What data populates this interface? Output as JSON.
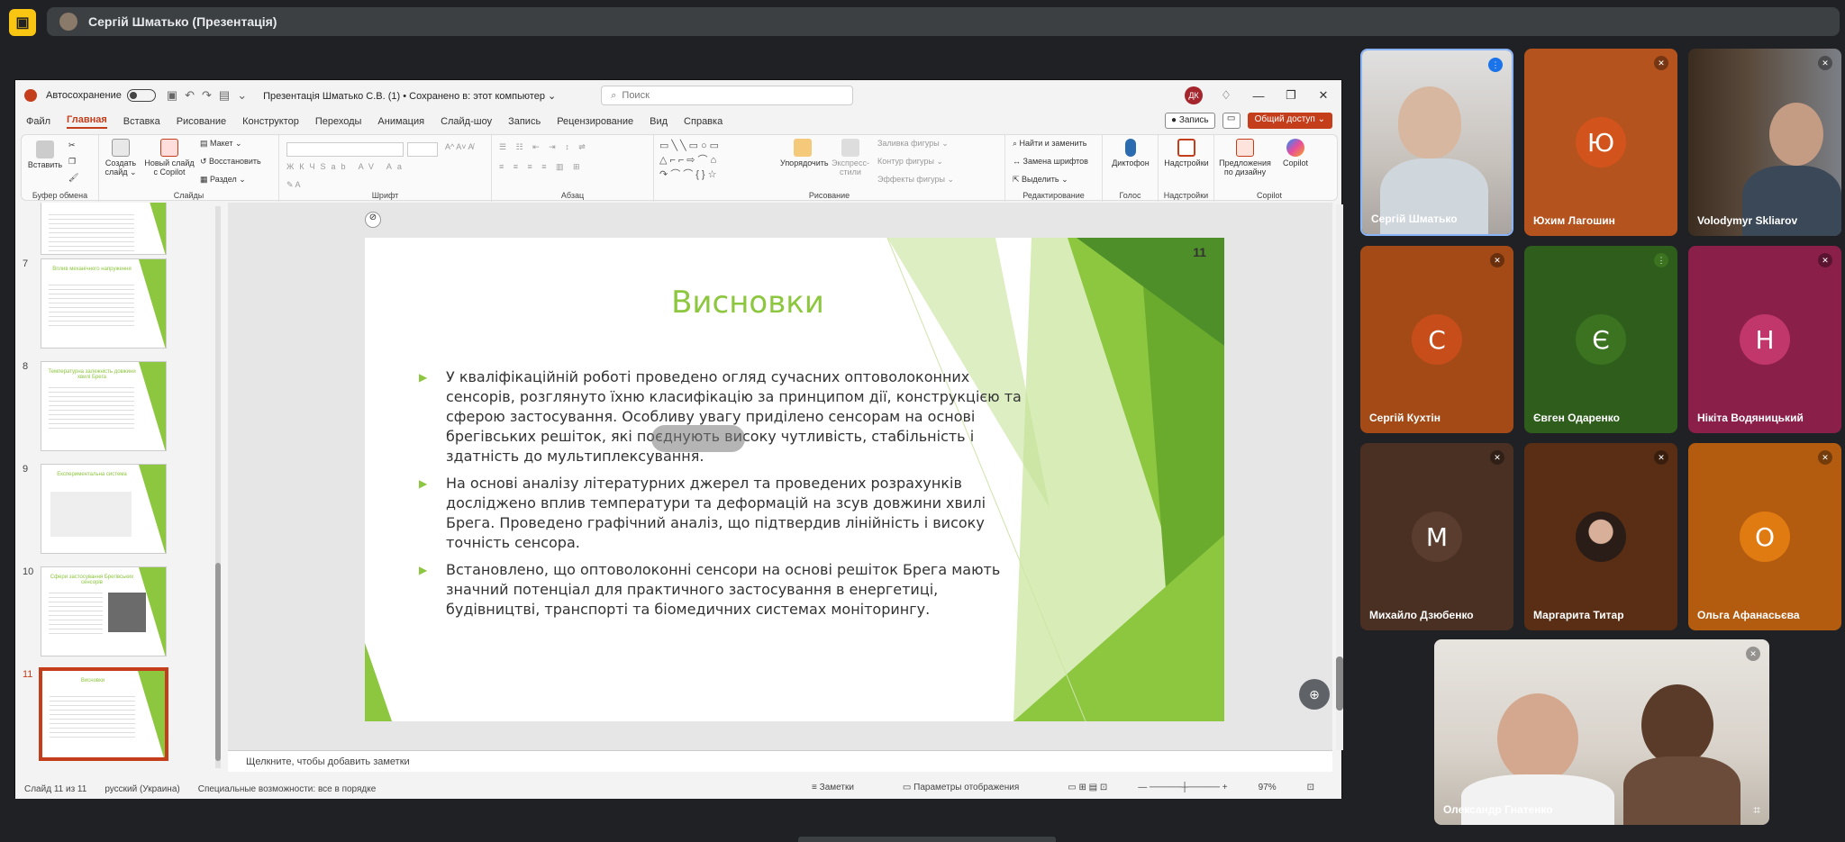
{
  "meet": {
    "presenter_label": "Сергій Шматько (Презентація)",
    "participants": [
      {
        "name": "Сергій Шматько",
        "initial": "",
        "color": "#cfcfcf",
        "type": "video",
        "mic": "speaking"
      },
      {
        "name": "Юхим Лагошин",
        "initial": "Ю",
        "color": "#b5531e",
        "avatar_color": "#d2541c",
        "type": "avatar",
        "mic": "off"
      },
      {
        "name": "Volodymyr Skliarov",
        "initial": "",
        "color": "#6a6a6a",
        "type": "video",
        "mic": "off"
      },
      {
        "name": "Сергій Кухтін",
        "initial": "С",
        "color": "#a34a16",
        "avatar_color": "#c74e1b",
        "type": "avatar",
        "mic": "off"
      },
      {
        "name": "Євген Одаренко",
        "initial": "Є",
        "color": "#2e5d1c",
        "avatar_color": "#3b7321",
        "type": "avatar",
        "mic": "speaking"
      },
      {
        "name": "Нікіта Водяницький",
        "initial": "Н",
        "color": "#8a1f4a",
        "avatar_color": "#c2376b",
        "type": "avatar",
        "mic": "off"
      },
      {
        "name": "Михайло Дзюбенко",
        "initial": "М",
        "color": "#4a3022",
        "avatar_color": "#5a3d2e",
        "type": "avatar",
        "mic": "off"
      },
      {
        "name": "Маргарита Титар",
        "initial": "",
        "color": "#5a2e14",
        "avatar_color": "#3a2a22",
        "type": "photo",
        "mic": "off"
      },
      {
        "name": "Ольга Афанасьєва",
        "initial": "О",
        "color": "#b35c10",
        "avatar_color": "#e07b12",
        "type": "avatar",
        "mic": "off"
      }
    ],
    "featured": {
      "name": "Олександр Гнатенко",
      "mic": "off"
    }
  },
  "ppt": {
    "autosave_label": "Автосохранение",
    "file_title": "Презентація Шматько С.В. (1) • Сохранено в: этот компьютер ⌄",
    "search_placeholder": "Поиск",
    "user_initials": "ДК",
    "tabs": [
      "Файл",
      "Главная",
      "Вставка",
      "Рисование",
      "Конструктор",
      "Переходы",
      "Анимация",
      "Слайд-шоу",
      "Запись",
      "Рецензирование",
      "Вид",
      "Справка"
    ],
    "record_label": "Запись",
    "share_label": "Общий доступ ⌄",
    "ribbon": {
      "paste": "Вставить",
      "clipboard_group": "Буфер обмена",
      "create_slide": "Создать слайд ⌄",
      "new_slide_copilot": "Новый слайд с Copilot",
      "layout": "Макет ⌄",
      "reset": "Восстановить",
      "section": "Раздел ⌄",
      "slides_group": "Слайды",
      "font_group": "Шрифт",
      "paragraph_group": "Абзац",
      "arrange": "Упорядочить",
      "quick_styles": "Экспресс-стили",
      "shape_fill": "Заливка фигуры ⌄",
      "shape_outline": "Контур фигуры ⌄",
      "shape_effects": "Эффекты фигуры ⌄",
      "drawing_group": "Рисование",
      "find_replace": "Найти и заменить",
      "replace_fonts": "Замена шрифтов",
      "select": "Выделить ⌄",
      "editing_group": "Редактирование",
      "dictate": "Диктофон",
      "voice_group": "Голос",
      "addins": "Надстройки",
      "addins_group": "Надстройки",
      "designer": "Предложения по дизайну",
      "copilot": "Copilot",
      "copilot_group": "Copilot"
    },
    "thumbnails": [
      {
        "num": "",
        "title": ""
      },
      {
        "num": "7",
        "title": "Вплив механічного напруження"
      },
      {
        "num": "8",
        "title": "Температурна залежність довжини хвилі Брега"
      },
      {
        "num": "9",
        "title": "Експериментальна система"
      },
      {
        "num": "10",
        "title": "Сфери застосування Брегівських сенсорів"
      },
      {
        "num": "11",
        "title": "Висновки"
      }
    ],
    "slide": {
      "number": "11",
      "title": "Висновки",
      "bullets": [
        "У кваліфікаційній роботі проведено огляд сучасних оптоволоконних сенсорів, розглянуто їхню класифікацію за принципом дії, конструкцією та сферою застосування. Особливу увагу приділено сенсорам на основі брегівських решіток, які поєднують високу чутливість, стабільність і здатність до мультиплексування.",
        "На основі аналізу літературних джерел та проведених розрахунків досліджено вплив температури та деформацій на зсув довжини хвилі Брега. Проведено графічний аналіз, що підтвердив лінійність і високу точність сенсора.",
        "Встановлено, що оптоволоконні сенсори на основі решіток Брега мають значний потенціал для практичного застосування в енергетиці, будівництві, транспорті та біомедичних системах моніторингу."
      ]
    },
    "notes_placeholder": "Щелкните, чтобы добавить заметки",
    "status": {
      "slide_of": "Слайд 11 из 11",
      "language": "русский (Украина)",
      "accessibility": "Специальные возможности: все в порядке",
      "notes": "Заметки",
      "display_settings": "Параметры отображения",
      "zoom": "97%"
    }
  },
  "colors": {
    "accent": "#c43e1c",
    "slide_green": "#8dc63f",
    "meet_bg": "#202124"
  }
}
